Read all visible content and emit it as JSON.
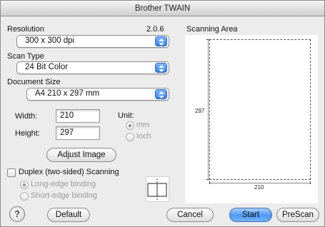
{
  "window": {
    "title": "Brother TWAIN"
  },
  "resolution": {
    "label": "Resolution",
    "value": "300 x 300 dpi",
    "version": "2.0.6"
  },
  "scan_type": {
    "label": "Scan Type",
    "value": "24 Bit Color"
  },
  "document_size": {
    "label": "Document Size",
    "value": "A4  210 x 297 mm"
  },
  "size_fields": {
    "width_label": "Width:",
    "width_value": "210",
    "height_label": "Height:",
    "height_value": "297"
  },
  "unit": {
    "label": "Unit:",
    "options": [
      "mm",
      "Inch"
    ],
    "selected": "mm"
  },
  "adjust_button": "Adjust Image",
  "duplex": {
    "label": "Duplex (two-sided) Scanning",
    "checked": false,
    "options": [
      "Long-edge binding",
      "Short-edge binding"
    ],
    "selected": "Long-edge binding"
  },
  "scanning_area": {
    "label": "Scanning Area",
    "width_tick": "210",
    "height_tick": "297"
  },
  "buttons": {
    "default": "Default",
    "cancel": "Cancel",
    "start": "Start",
    "prescan": "PreScan"
  },
  "help_glyph": "?",
  "icons": [
    "help-icon",
    "popup-arrow-icon",
    "duplex-binding-icon"
  ]
}
